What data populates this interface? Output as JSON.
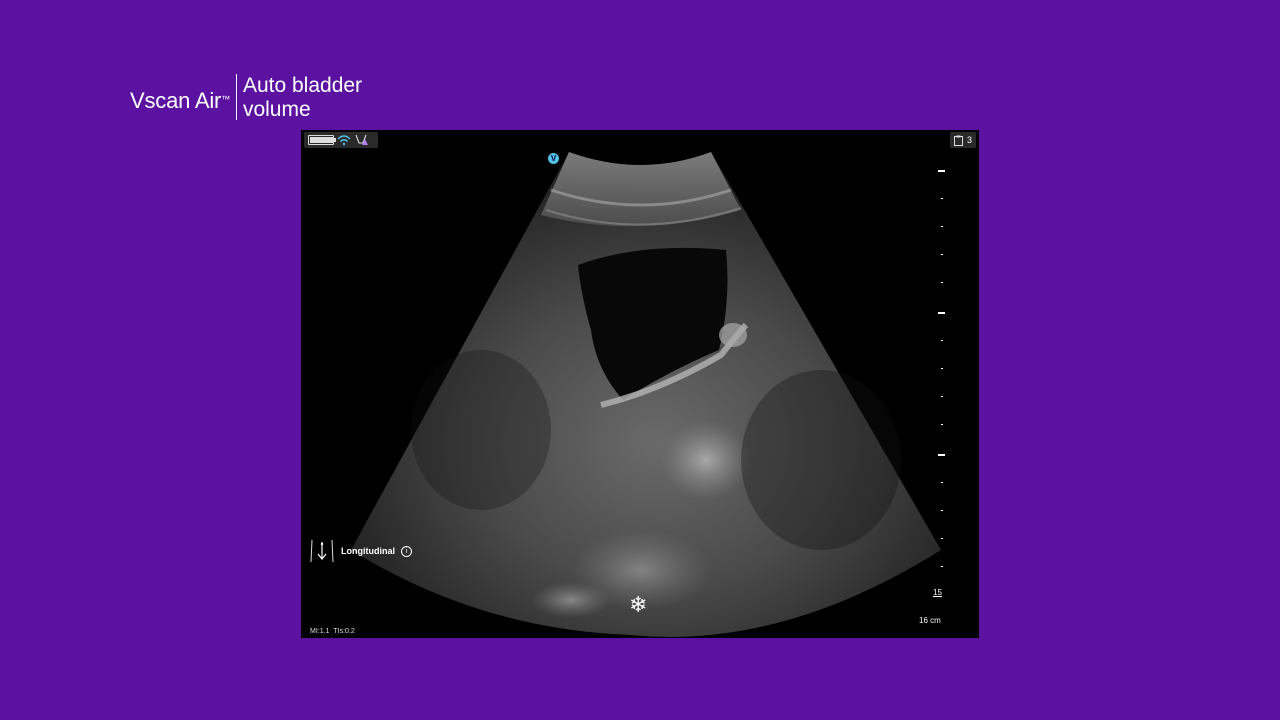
{
  "header": {
    "brand": "Vscan Air",
    "trademark": "™",
    "title_line1": "Auto bladder",
    "title_line2": "volume"
  },
  "screen": {
    "status": {
      "battery_level": 1.0,
      "wifi_icon": "wifi-icon",
      "probe_icon": "probe-warning-icon"
    },
    "clipboard_count": "3",
    "v_badge": "V",
    "orientation_label": "Longitudinal",
    "info_symbol": "i",
    "freeze_icon": "❄",
    "depth_mark": "15",
    "depth_total": "16 cm",
    "mi_label": "MI:1.1",
    "tis_label": "TIs:0.2"
  },
  "colors": {
    "background": "#5b12a0",
    "accent_badge": "#4fc2e8"
  }
}
